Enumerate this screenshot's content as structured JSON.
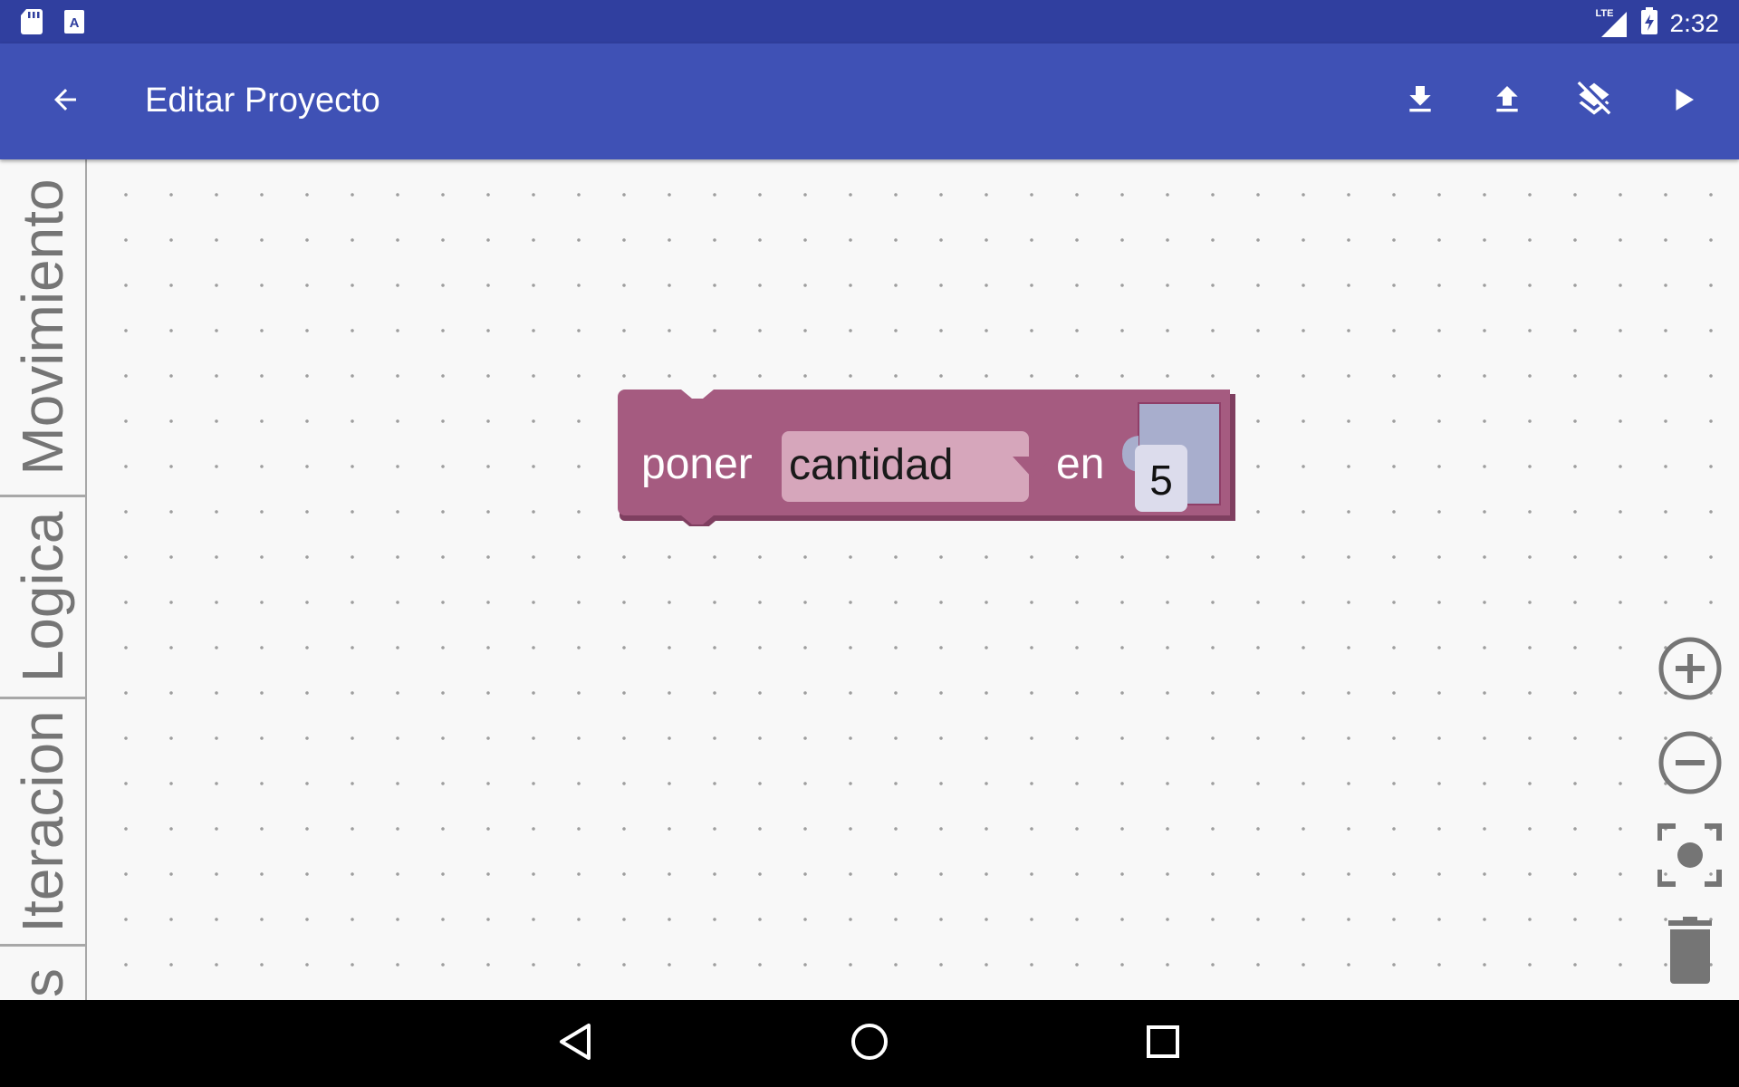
{
  "status_bar": {
    "network": "LTE",
    "time": "2:32",
    "icons": [
      "sd-card-icon",
      "text-a-icon",
      "lte-signal-icon",
      "battery-charging-icon"
    ]
  },
  "app_bar": {
    "title": "Editar Proyecto",
    "back_icon": "arrow-back-icon",
    "actions": [
      {
        "icon": "download-icon"
      },
      {
        "icon": "upload-icon"
      },
      {
        "icon": "layers-clear-icon"
      },
      {
        "icon": "play-icon"
      }
    ]
  },
  "toolbox": {
    "tabs": [
      {
        "label": "Movimiento"
      },
      {
        "label": "Logica"
      },
      {
        "label": "Iteracion"
      },
      {
        "label": "s"
      }
    ]
  },
  "block": {
    "color": "#a55b80",
    "prefix": "poner",
    "variable": "cantidad",
    "middle": "en",
    "value": "5"
  },
  "controls": {
    "icons": [
      "zoom-in-icon",
      "zoom-out-icon",
      "recenter-icon",
      "trash-icon"
    ]
  },
  "nav_bar": {
    "icons": [
      "nav-back-icon",
      "nav-home-icon",
      "nav-recents-icon"
    ]
  }
}
